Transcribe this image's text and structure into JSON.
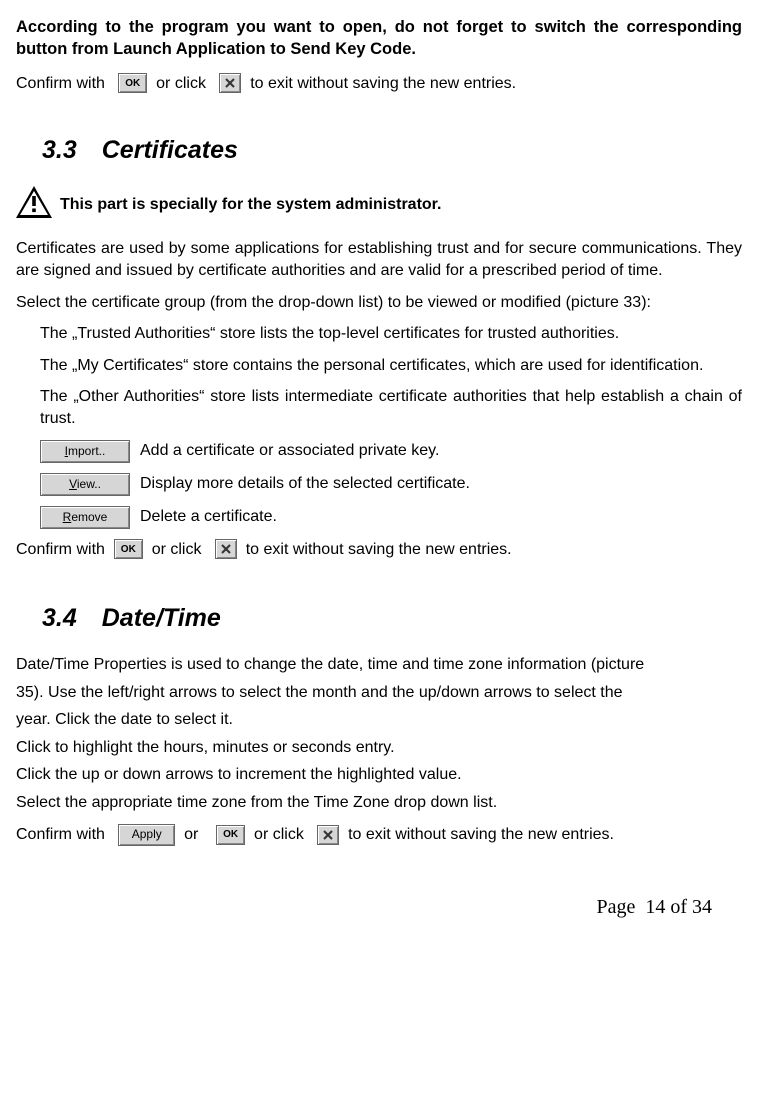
{
  "intro_bold": "According to the program you want to open, do not forget to switch the corresponding button from Launch Application to Send Key Code.",
  "confirm1_a": "Confirm with",
  "confirm1_b": "or click",
  "confirm1_c": "to exit without saving the new entries.",
  "ok_label": "OK",
  "section33": "3.3 Certificates",
  "admin_note": "This part is specially for the system administrator.",
  "cert_intro": "Certificates are used by some applications for establishing trust and for secure communications. They are signed and issued by certificate authorities and are valid for a prescribed period of time.",
  "cert_select": "Select the certificate group (from the drop-down list) to be viewed or modified (picture 33):",
  "trusted": "The „Trusted Authorities“ store lists the top-level certificates for trusted authorities.",
  "mycerts": "The „My Certificates“ store contains the personal certificates, which are used for identification.",
  "other": "The „Other Authorities“ store lists intermediate certificate authorities that help establish a chain of trust.",
  "import_btn": "Import..",
  "import_desc": "Add a certificate or associated private key.",
  "view_btn": "View..",
  "view_desc": "Display more details of the selected certificate.",
  "remove_btn": "Remove",
  "remove_desc": "Delete a certificate.",
  "confirm2_a": "Confirm with",
  "confirm2_b": "or click",
  "confirm2_c": "to exit without saving the new entries.",
  "section34": "3.4 Date/Time",
  "dt_l1": "Date/Time Properties is used to change the date, time and time zone information (picture",
  "dt_l2": "35). Use the left/right arrows to select the month and the up/down arrows to select the",
  "dt_l3": "year. Click the date to select it.",
  "dt_l4": "Click to highlight the hours, minutes or seconds entry.",
  "dt_l5": "Click the up or down arrows to increment the highlighted value.",
  "dt_l6": "Select the appropriate time zone from the Time Zone drop down list.",
  "apply_label": "Apply",
  "confirm3_a": "Confirm with",
  "confirm3_b": "or",
  "confirm3_c": "or click",
  "confirm3_d": "to exit without saving the new entries.",
  "page_footer": "Page  14 of 34"
}
